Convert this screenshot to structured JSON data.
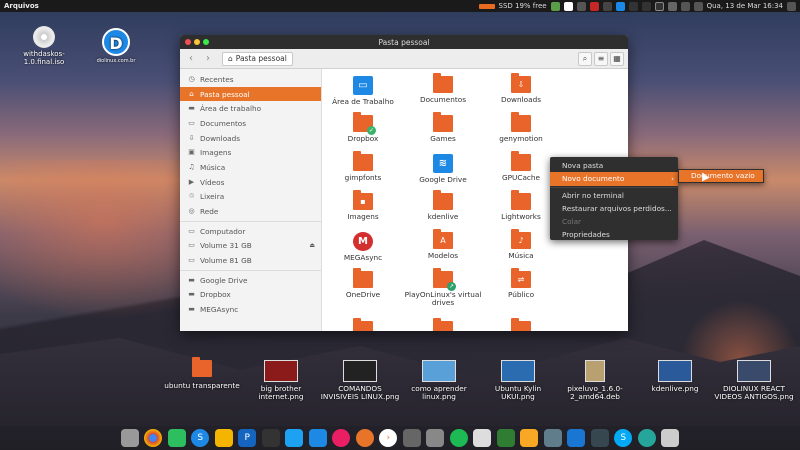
{
  "topbar": {
    "app_menu": "Arquivos",
    "ssd": "SSD 19% free",
    "clock": "Qua, 13 de Mar 16:34"
  },
  "desktop": {
    "iso_label": "withdaskos-1.0.final.iso",
    "logo_text": "diolinux.com.br",
    "bottom_files": [
      {
        "label": "ubuntu transparente"
      },
      {
        "label": "big brother internet.png"
      },
      {
        "label": "COMANDOS INVISIVEIS LINUX.png"
      },
      {
        "label": "como aprender linux.png"
      },
      {
        "label": "Ubuntu Kylin UKUI.png"
      },
      {
        "label": "pixeluvo_1.6.0-2_amd64.deb"
      },
      {
        "label": "kdenlive.png"
      },
      {
        "label": "DIOLINUX REACT VIDEOS ANTIGOS.png"
      }
    ]
  },
  "window": {
    "title": "Pasta pessoal",
    "breadcrumb": "Pasta pessoal",
    "sidebar": [
      {
        "label": "Recentes",
        "icon": "clock-icon"
      },
      {
        "label": "Pasta pessoal",
        "icon": "home-icon",
        "active": true
      },
      {
        "label": "Área de trabalho",
        "icon": "folder-icon"
      },
      {
        "label": "Documentos",
        "icon": "document-icon"
      },
      {
        "label": "Downloads",
        "icon": "download-icon"
      },
      {
        "label": "Imagens",
        "icon": "image-icon"
      },
      {
        "label": "Música",
        "icon": "music-icon"
      },
      {
        "label": "Vídeos",
        "icon": "video-icon"
      },
      {
        "label": "Lixeira",
        "icon": "trash-icon"
      },
      {
        "label": "Rede",
        "icon": "network-icon"
      },
      {
        "label": "Computador",
        "icon": "computer-icon"
      },
      {
        "label": "Volume 31 GB",
        "icon": "drive-icon"
      },
      {
        "label": "Volume 81 GB",
        "icon": "drive-icon"
      },
      {
        "label": "Google Drive",
        "icon": "folder-icon"
      },
      {
        "label": "Dropbox",
        "icon": "folder-icon"
      },
      {
        "label": "MEGAsync",
        "icon": "folder-icon"
      }
    ],
    "files": [
      {
        "label": "Área de Trabalho"
      },
      {
        "label": "Documentos"
      },
      {
        "label": "Downloads"
      },
      {
        "label": "Dropbox"
      },
      {
        "label": "Games"
      },
      {
        "label": "genymotion"
      },
      {
        "label": "gimpfonts"
      },
      {
        "label": "Google Drive"
      },
      {
        "label": "GPUCache"
      },
      {
        "label": "Imagens"
      },
      {
        "label": "kdenlive"
      },
      {
        "label": "Lightworks"
      },
      {
        "label": "MEGAsync"
      },
      {
        "label": "Modelos"
      },
      {
        "label": "Música"
      },
      {
        "label": "OneDrive"
      },
      {
        "label": "PlayOnLinux's virtual drives"
      },
      {
        "label": "Público"
      }
    ]
  },
  "context_menu": {
    "items": [
      "Nova pasta",
      "Novo documento",
      "Abrir no terminal",
      "Restaurar arquivos perdidos...",
      "Colar",
      "Propriedades"
    ],
    "submenu_item": "Documento vazio"
  },
  "colors": {
    "accent": "#e8742a",
    "titlebar": "#2e2e2e"
  }
}
